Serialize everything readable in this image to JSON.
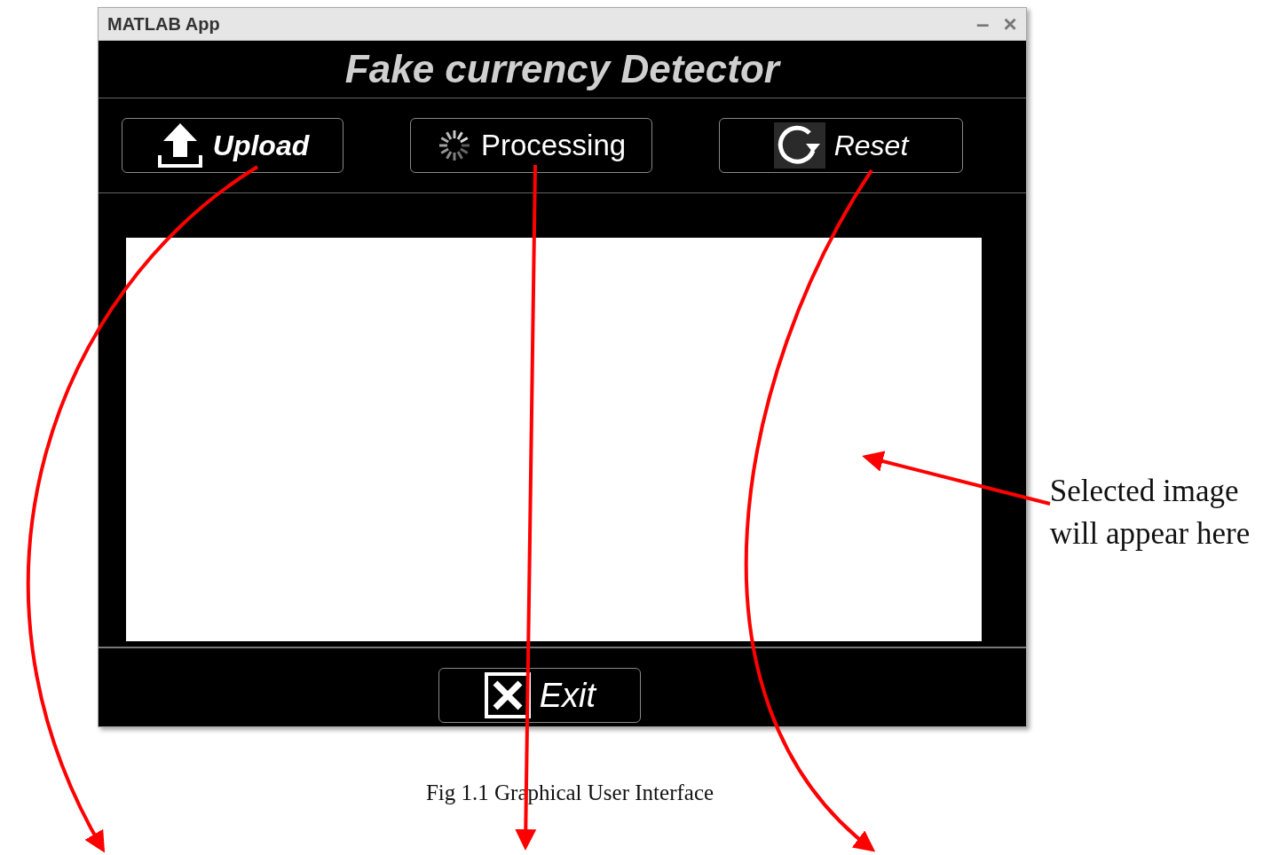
{
  "window": {
    "title": "MATLAB App",
    "controls": [
      "–",
      "×"
    ]
  },
  "app_title": "Fake currency Detector",
  "buttons": [
    {
      "kind": "upload",
      "label": "Upload"
    },
    {
      "kind": "processing",
      "label": "Processing"
    },
    {
      "kind": "reset",
      "label": "Reset"
    }
  ],
  "exit_button": {
    "kind": "exit",
    "label": "Exit"
  },
  "callout": "Selected image will appear here",
  "caption": "Fig 1.1 Graphical User Interface"
}
